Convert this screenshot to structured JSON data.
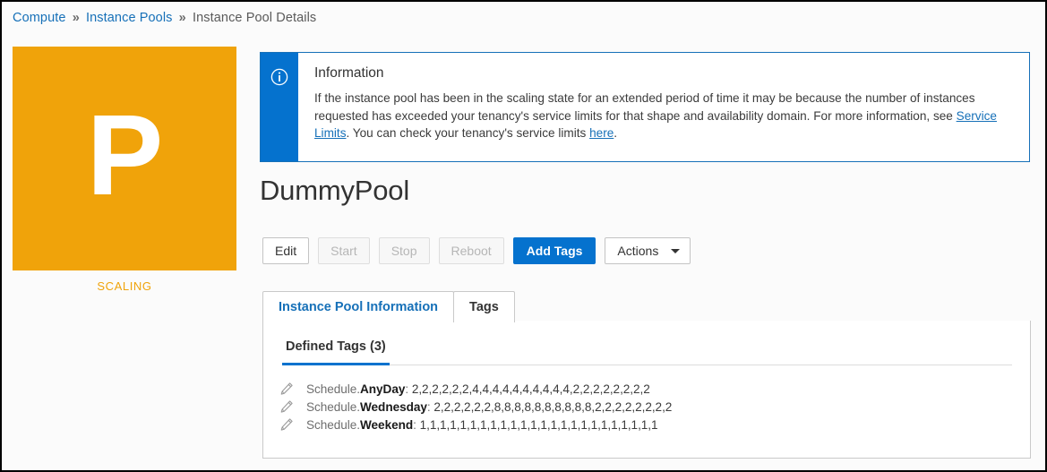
{
  "breadcrumb": {
    "items": [
      {
        "label": "Compute",
        "link": true
      },
      {
        "label": "Instance Pools",
        "link": true
      },
      {
        "label": "Instance Pool Details",
        "link": false
      }
    ],
    "separator": "»"
  },
  "avatar": {
    "letter": "P",
    "status": "SCALING",
    "color": "#f0a30a",
    "icon": "instance-pool-avatar"
  },
  "info_banner": {
    "icon": "info-circle-icon",
    "title": "Information",
    "text_part_1": "If the instance pool has been in the scaling state for an extended period of time it may be because the number of instances requested has exceeded your tenancy's service limits for that shape and availability domain. For more information, see ",
    "link_1": "Service Limits",
    "text_part_2": ". You can check your tenancy's service limits ",
    "link_2": "here",
    "text_part_3": ".",
    "accent_color": "#0572ce"
  },
  "page_title": "DummyPool",
  "toolbar": {
    "buttons": [
      {
        "label": "Edit",
        "state": "enabled",
        "style": "default"
      },
      {
        "label": "Start",
        "state": "disabled",
        "style": "default"
      },
      {
        "label": "Stop",
        "state": "disabled",
        "style": "default"
      },
      {
        "label": "Reboot",
        "state": "disabled",
        "style": "default"
      },
      {
        "label": "Add Tags",
        "state": "enabled",
        "style": "primary"
      },
      {
        "label": "Actions",
        "state": "enabled",
        "style": "dropdown"
      }
    ]
  },
  "tabs": [
    {
      "label": "Instance Pool Information",
      "active": false
    },
    {
      "label": "Tags",
      "active": true
    }
  ],
  "tags_panel": {
    "section_title": "Defined Tags (3)",
    "rows": [
      {
        "icon": "pencil-edit-icon",
        "namespace": "Schedule.",
        "key": "AnyDay",
        "separator": ": ",
        "value": "2,2,2,2,2,2,4,4,4,4,4,4,4,4,4,4,2,2,2,2,2,2,2,2"
      },
      {
        "icon": "pencil-edit-icon",
        "namespace": "Schedule.",
        "key": "Wednesday",
        "separator": ": ",
        "value": "2,2,2,2,2,2,8,8,8,8,8,8,8,8,8,8,2,2,2,2,2,2,2,2"
      },
      {
        "icon": "pencil-edit-icon",
        "namespace": "Schedule.",
        "key": "Weekend",
        "separator": ": ",
        "value": "1,1,1,1,1,1,1,1,1,1,1,1,1,1,1,1,1,1,1,1,1,1,1,1"
      }
    ]
  }
}
